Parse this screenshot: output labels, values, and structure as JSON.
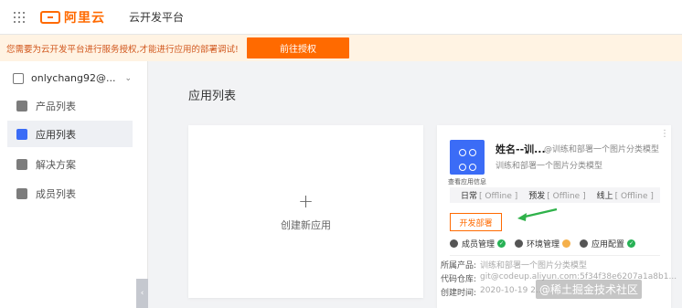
{
  "header": {
    "logo_text": "阿里云",
    "platform_title": "云开发平台"
  },
  "banner": {
    "message": "您需要为云开发平台进行服务授权,才能进行应用的部署调试!",
    "button_label": "前往授权"
  },
  "sidebar": {
    "account": "onlychang92@...",
    "items": [
      {
        "label": "产品列表",
        "icon": "product-icon"
      },
      {
        "label": "应用列表",
        "icon": "app-list-icon",
        "active": true
      },
      {
        "label": "解决方案",
        "icon": "solution-icon"
      },
      {
        "label": "成员列表",
        "icon": "member-icon"
      }
    ]
  },
  "main": {
    "title": "应用列表",
    "create_label": "创建新应用",
    "app": {
      "name": "姓名--训...",
      "desc_inline": "@训练和部署一个图片分类模型",
      "desc": "训练和部署一个图片分类模型",
      "view_info": "查看应用信息",
      "envs": [
        {
          "label": "日常",
          "status": "[ Offline ]"
        },
        {
          "label": "预发",
          "status": "[ Offline ]"
        },
        {
          "label": "线上",
          "status": "[ Offline ]"
        }
      ],
      "deploy_label": "开发部署",
      "statuses": [
        {
          "label": "成员管理",
          "state": "ok"
        },
        {
          "label": "环境管理",
          "state": "warn"
        },
        {
          "label": "应用配置",
          "state": "ok"
        }
      ],
      "meta": [
        {
          "key": "所属产品:",
          "value": "训练和部署一个图片分类模型"
        },
        {
          "key": "代码仓库:",
          "value": "git@codeup.aliyun.com:5f34f38e6207a1a8b1..."
        },
        {
          "key": "创建时间:",
          "value": "2020-10-19 2..."
        }
      ]
    }
  },
  "watermark": "@稀土掘金技术社区",
  "colors": {
    "brand": "#ff6a00",
    "active_nav": "#3b6cf6",
    "ok": "#27b155",
    "arrow": "#2fb24a"
  }
}
